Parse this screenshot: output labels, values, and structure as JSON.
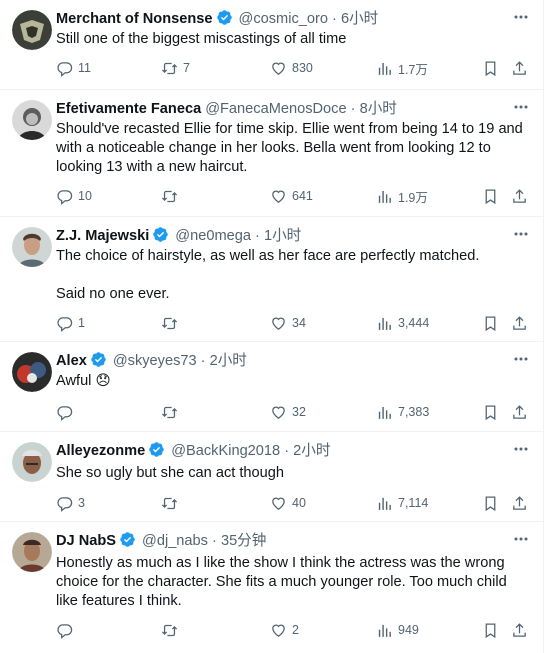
{
  "tweets": [
    {
      "name": "Merchant of Nonsense",
      "verified": true,
      "handle": "@cosmic_oro",
      "separator": "·",
      "time": "6小时",
      "text": "Still one of the biggest miscastings of all time",
      "replies": "11",
      "retweets": "7",
      "likes": "830",
      "views": "1.7万"
    },
    {
      "name": "Efetivamente Faneca",
      "verified": false,
      "handle": "@FanecaMenosDoce",
      "separator": "·",
      "time": "8小时",
      "text": "Should've recasted Ellie for time skip. Ellie went from being 14 to 19 and with a noticeable change in her looks. Bella went from looking 12 to looking 13 with a new haircut.",
      "replies": "10",
      "retweets": "",
      "likes": "641",
      "views": "1.9万"
    },
    {
      "name": "Z.J. Majewski",
      "verified": true,
      "handle": "@ne0mega",
      "separator": "·",
      "time": "1小时",
      "text": "The choice of hairstyle, as well as her face are perfectly matched.\n\nSaid no one ever.",
      "replies": "1",
      "retweets": "",
      "likes": "34",
      "views": "3,444"
    },
    {
      "name": "Alex",
      "verified": true,
      "handle": "@skyeyes73",
      "separator": "·",
      "time": "2小时",
      "text": "Awful",
      "emoji": "😞",
      "replies": "",
      "retweets": "",
      "likes": "32",
      "views": "7,383"
    },
    {
      "name": "Alleyezonme",
      "verified": true,
      "handle": "@BackKing2018",
      "separator": "·",
      "time": "2小时",
      "text": "She so ugly but she can act though",
      "replies": "3",
      "retweets": "",
      "likes": "40",
      "views": "7,114"
    },
    {
      "name": "DJ NabS",
      "verified": true,
      "handle": "@dj_nabs",
      "separator": "·",
      "time": "35分钟",
      "text": "Honestly as much as I like the show I think the actress was the wrong choice for the character. She fits a much younger role. Too much child like features I think.",
      "replies": "",
      "retweets": "",
      "likes": "2",
      "views": "949"
    }
  ],
  "icons": {
    "reply": "reply-icon",
    "retweet": "retweet-icon",
    "like": "heart-icon",
    "views": "views-chart-icon",
    "bookmark": "bookmark-icon",
    "share": "share-icon",
    "more": "more-dots-icon",
    "verified": "verified-badge-icon"
  },
  "colors": {
    "text": "#0f1419",
    "secondary": "#536471",
    "verified": "#1d9bf0",
    "divider": "#eff3f4"
  }
}
